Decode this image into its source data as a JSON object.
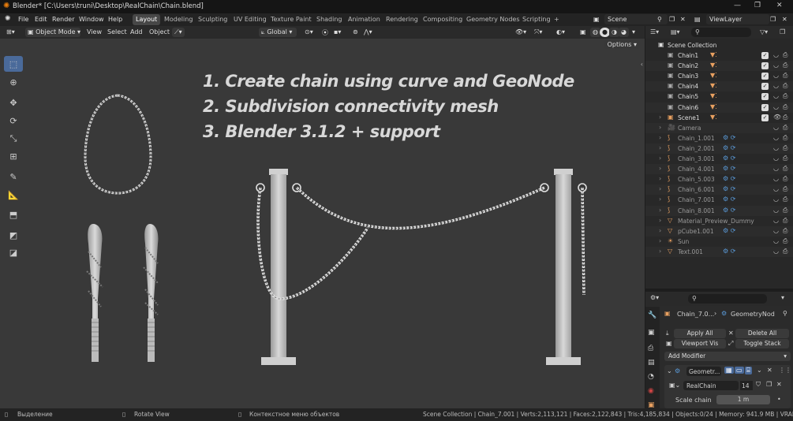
{
  "window": {
    "title": "Blender* [C:\\Users\\truni\\Desktop\\RealChain\\Chain.blend]"
  },
  "menu": [
    "File",
    "Edit",
    "Render",
    "Window",
    "Help"
  ],
  "workspaces": [
    "Layout",
    "Modeling",
    "Sculpting",
    "UV Editing",
    "Texture Paint",
    "Shading",
    "Animation",
    "Rendering",
    "Compositing",
    "Geometry Nodes",
    "Scripting"
  ],
  "active_workspace": "Layout",
  "scene": "Scene",
  "view_layer": "ViewLayer",
  "viewport_header": {
    "mode": "Object Mode",
    "menus": [
      "View",
      "Select",
      "Add",
      "Object"
    ],
    "transform": "Global",
    "options": "Options"
  },
  "overlay_text": [
    "1. Create chain using curve and GeoNode",
    "2. Subdivision connectivity mesh",
    "3. Blender 3.1.2 + support"
  ],
  "outliner": {
    "root": "Scene Collection",
    "items": [
      {
        "name": "Chain1",
        "checked": true
      },
      {
        "name": "Chain2",
        "checked": true
      },
      {
        "name": "Chain3",
        "checked": true
      },
      {
        "name": "Chain4",
        "checked": true
      },
      {
        "name": "Chain5",
        "checked": true
      },
      {
        "name": "Chain6",
        "checked": true
      },
      {
        "name": "Scene1",
        "checked": true
      },
      {
        "name": "Camera",
        "checked": false
      },
      {
        "name": "Chain_1.001",
        "checked": false
      },
      {
        "name": "Chain_2.001",
        "checked": false
      },
      {
        "name": "Chain_3.001",
        "checked": false
      },
      {
        "name": "Chain_4.001",
        "checked": false
      },
      {
        "name": "Chain_5.003",
        "checked": false
      },
      {
        "name": "Chain_6.001",
        "checked": false
      },
      {
        "name": "Chain_7.001",
        "checked": false
      },
      {
        "name": "Chain_8.001",
        "checked": false
      },
      {
        "name": "Material_Preview_Dummy",
        "checked": false
      },
      {
        "name": "pCube1.001",
        "checked": false
      },
      {
        "name": "Sun",
        "checked": false
      },
      {
        "name": "Text.001",
        "checked": false
      }
    ]
  },
  "properties": {
    "object": "Chain_7.0...",
    "modifier_tab": "GeometryNod",
    "apply_all": "Apply All",
    "delete_all": "Delete All",
    "viewport_vis": "Viewport Vis",
    "toggle_stack": "Toggle Stack",
    "add_modifier": "Add Modifier",
    "modifier_name": "Geometr...",
    "node_group": "RealChain",
    "node_users": "14",
    "param_label": "Scale chain",
    "param_value": "1 m"
  },
  "status": {
    "select": "Выделение",
    "rotate": "Rotate View",
    "context": "Контекстное меню объектов",
    "stats": "Scene Collection | Chain_7.001 | Verts:2,113,121 | Faces:2,122,843 | Tris:4,185,834 | Objects:0/24 | Memory: 941.9 MB | VRAM: 1.8/6.0 GB"
  },
  "colors": {
    "accent": "#4a6a9a",
    "viewport_bg": "#393939",
    "object_orange": "#e8a060",
    "modifier_blue": "#5a9ad8"
  }
}
